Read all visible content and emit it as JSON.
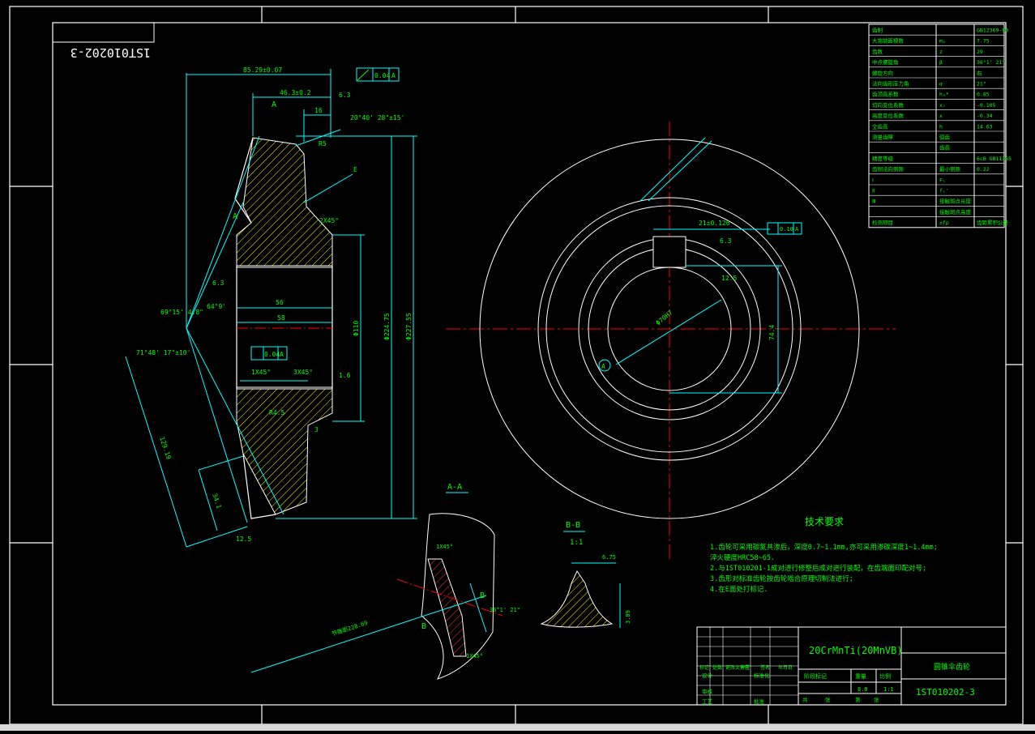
{
  "drawing": {
    "number_mirrored": "1ST010202-3",
    "material": "20CrMnTi(20MnVB)",
    "part_name": "圆锥伞齿轮",
    "drawing_no": "1ST010202-3",
    "scale": "1:1",
    "weight": "8.8"
  },
  "title_block_headers": {
    "stage": "阶段标记",
    "weight": "重量",
    "scale": "比例",
    "sheet": "共",
    "sheets": "张",
    "sheet_no": "第",
    "sheet_of": "张",
    "design": "设计",
    "check": "审核",
    "process": "工艺",
    "approve": "批准",
    "std": "标准化",
    "mark": "标记",
    "count": "处数",
    "zone": "分区",
    "change_doc": "更改文件号",
    "sign": "签名",
    "date": "年月日"
  },
  "gear_table": {
    "rows": [
      {
        "name": "齿制",
        "symbol": "",
        "value": "GB12369-90"
      },
      {
        "name": "大端端面模数",
        "symbol": "mₑ",
        "value": "7.75"
      },
      {
        "name": "齿数",
        "symbol": "z",
        "value": "29"
      },
      {
        "name": "中点螺旋角",
        "symbol": "β",
        "value": "36°1' 21\""
      },
      {
        "name": "螺旋方向",
        "symbol": "",
        "value": "右"
      },
      {
        "name": "法向齿形压力角",
        "symbol": "α",
        "value": "21°"
      },
      {
        "name": "齿顶高系数",
        "symbol": "hₐ*",
        "value": "0.85"
      },
      {
        "name": "切向变位系数",
        "symbol": "xₜ",
        "value": "-0.105"
      },
      {
        "name": "高度变位系数",
        "symbol": "x",
        "value": "-0.34"
      },
      {
        "name": "全齿高",
        "symbol": "h",
        "value": "14.63"
      },
      {
        "name": "测量齿厚",
        "symbol": "弧齿",
        "value": ""
      },
      {
        "name": "",
        "symbol": "齿高",
        "value": ""
      },
      {
        "name": "精度等级",
        "symbol": "",
        "value": "6cB  GB11365"
      },
      {
        "name": "齿侧法向侧隙",
        "symbol": "最小侧隙",
        "value": "0.22"
      },
      {
        "name": "Ⅰ",
        "symbol": "Fᵢ",
        "value": ""
      },
      {
        "name": "Ⅱ",
        "symbol": "fᵢ'",
        "value": ""
      },
      {
        "name": "Ⅲ",
        "symbol": "接触斑点长度",
        "value": ""
      },
      {
        "name": "",
        "symbol": "接触斑点高度",
        "value": ""
      },
      {
        "name": "检测项目",
        "symbol": "±fp",
        "value": "齿距累积公差"
      }
    ]
  },
  "tech_requirements": {
    "title": "技术要求",
    "items": [
      "1.齿轮可采用碳氮共渗后，深度0.7~1.1mm,亦可采用渗碳深度1~1.4mm;",
      "  淬火硬度HRC58~65.",
      "2.与1ST010201-1成对进行修整后成对进行装配，在齿端面印配对号;",
      "3.齿形对标准齿轮按齿轮啮合原理切制法进行;",
      "4.在E面处打标记."
    ]
  },
  "dims": {
    "d85": "85.29±0.07",
    "d46": "46.3±0.2",
    "d16": "16",
    "tol_top": "0.04",
    "tol_mid": "0.04",
    "tol_right": "0.10",
    "datum": "A",
    "ang20": "20°40' 28\"±15'",
    "r5": "R5",
    "e": "E",
    "c2x45": "2X45°",
    "d56": "56",
    "d58": "58",
    "d110": "Φ110",
    "d224": "Φ224.75",
    "d227": "Φ227.55",
    "d69": "69°15' 4.8\"",
    "d64": "64°9'",
    "d71": "71°48' 17\"±10'",
    "c1x45": "1X45°",
    "c3x45": "3X45°",
    "r45": "R4.5",
    "d3": "3",
    "d129": "129.19",
    "d34": "34.1",
    "ra63": "6.3",
    "ra125": "12.5",
    "ra16": "1.6",
    "d21": "21±0.126",
    "d74": "74.4",
    "d70": "Φ70H7",
    "sec_aa": "A-A",
    "sec_bb": "B-B",
    "scale_bb": "1:1",
    "d675": "6.75",
    "d389": "3.89",
    "ang36": "36°1' 21\"",
    "dist228": "节锥距228.69",
    "lbl_b": "B",
    "lbl_a": "A"
  },
  "colors": {
    "frame": "#ffffff",
    "dimension": "#00ffff",
    "hatch": "#ffff00",
    "centerline": "#ff0000",
    "text": "#00ff00"
  }
}
